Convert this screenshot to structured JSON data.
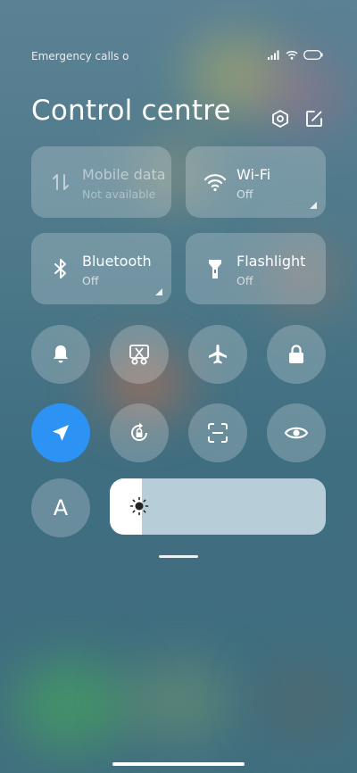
{
  "status": {
    "carrier_text": "Emergency calls o",
    "icons": [
      "signal-icon",
      "wifi-icon",
      "battery-icon"
    ]
  },
  "header": {
    "title": "Control centre",
    "icons": [
      "settings-icon",
      "edit-icon"
    ]
  },
  "tiles": [
    {
      "label": "Mobile data",
      "sub": "Not available",
      "icon": "mobile-data-icon"
    },
    {
      "label": "Wi-Fi",
      "sub": "Off",
      "icon": "wifi-icon"
    },
    {
      "label": "Bluetooth",
      "sub": "Off",
      "icon": "bluetooth-icon"
    },
    {
      "label": "Flashlight",
      "sub": "Off",
      "icon": "flashlight-icon"
    }
  ],
  "toggles": [
    {
      "icon": "bell-icon",
      "active": false
    },
    {
      "icon": "screenshot-icon",
      "active": false
    },
    {
      "icon": "airplane-icon",
      "active": false
    },
    {
      "icon": "lock-icon",
      "active": false
    },
    {
      "icon": "location-icon",
      "active": true
    },
    {
      "icon": "rotation-lock-icon",
      "active": false
    },
    {
      "icon": "scanner-icon",
      "active": false
    },
    {
      "icon": "eye-icon",
      "active": false
    },
    {
      "icon": "auto-brightness-icon",
      "glyph": "A",
      "active": false
    }
  ],
  "brightness": {
    "level_percent": 15,
    "icon": "sun-icon"
  },
  "colors": {
    "active_toggle": "#2c93f5",
    "tile_bg": "rgba(255,255,255,0.22)"
  }
}
